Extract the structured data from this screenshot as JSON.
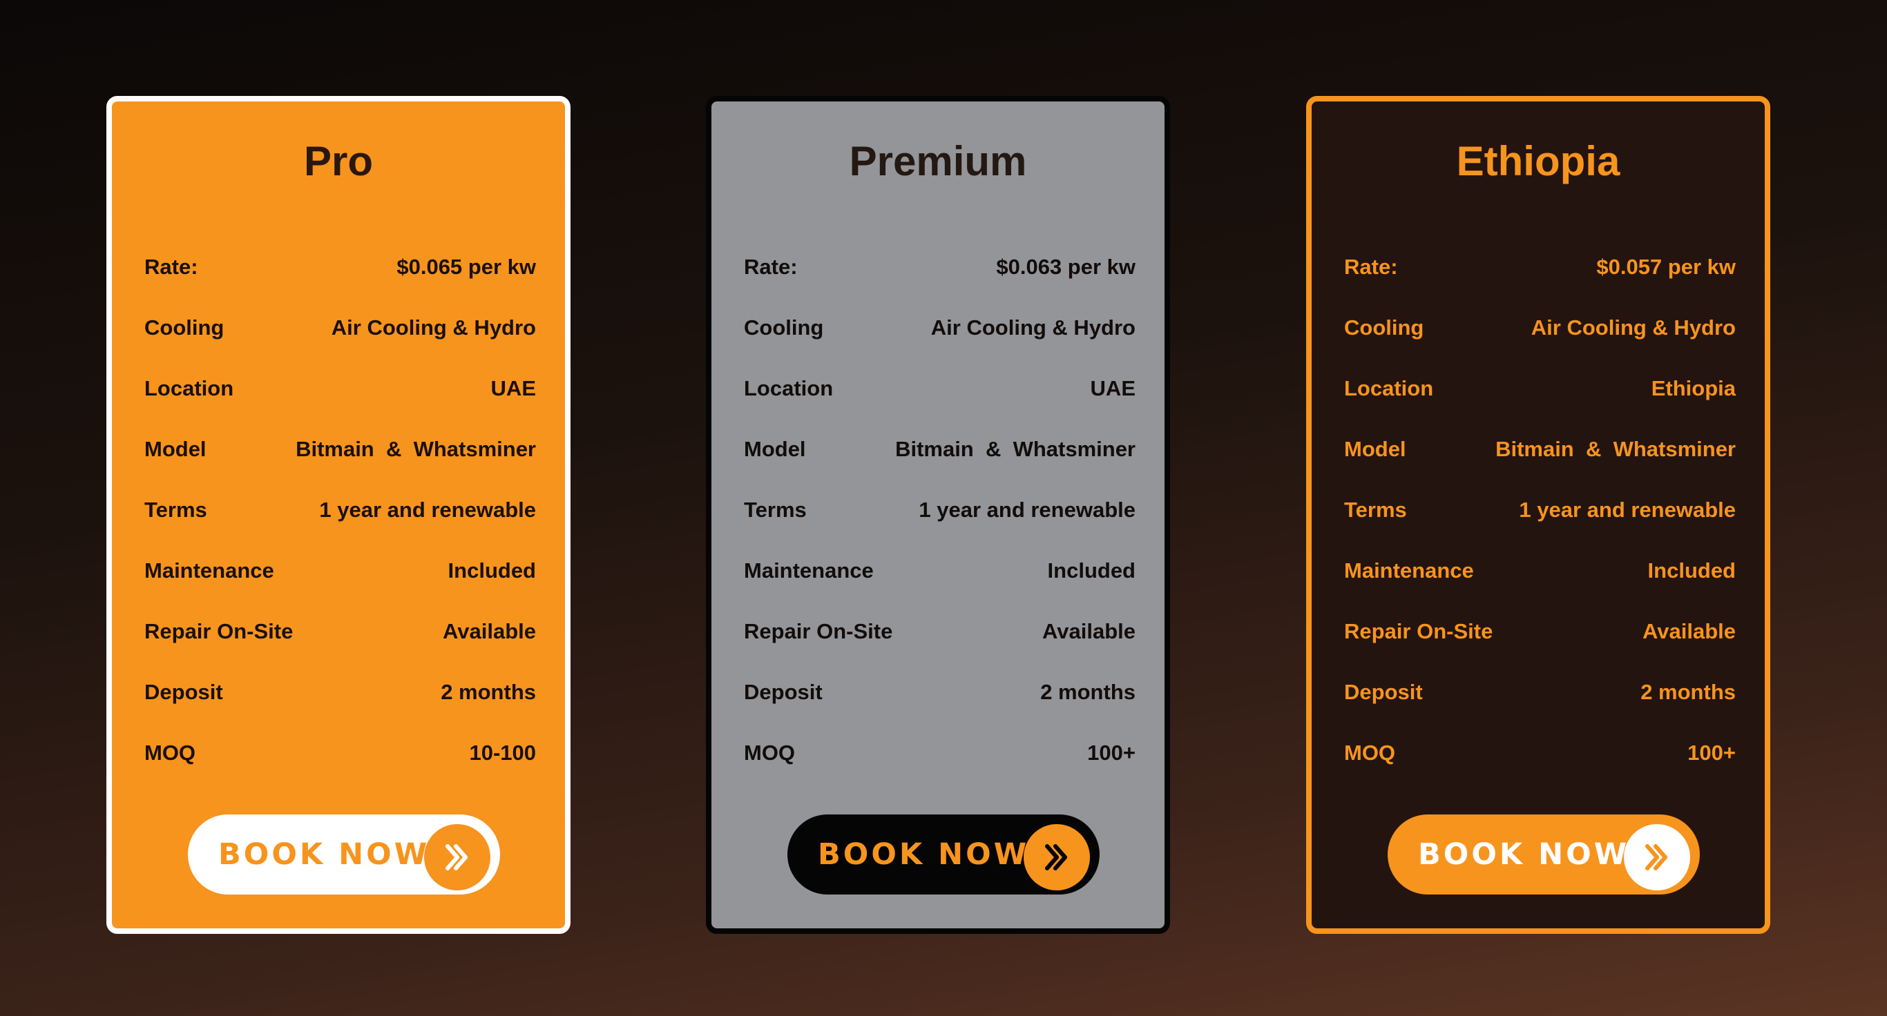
{
  "colors": {
    "accent": "#f7941d",
    "premium_bg": "#939598",
    "dark_bg": "#241410"
  },
  "plans": [
    {
      "id": "pro",
      "title": "Pro",
      "rows": [
        {
          "label": "Rate:",
          "value": "$0.065 per kw"
        },
        {
          "label": "Cooling",
          "value": "Air Cooling & Hydro"
        },
        {
          "label": "Location",
          "value": "UAE"
        },
        {
          "label": "Model",
          "value": "Bitmain  &  Whatsminer"
        },
        {
          "label": "Terms",
          "value": "1 year and renewable"
        },
        {
          "label": "Maintenance",
          "value": "Included"
        },
        {
          "label": "Repair On-Site",
          "value": "Available"
        },
        {
          "label": "Deposit",
          "value": "2 months"
        },
        {
          "label": "MOQ",
          "value": "10-100"
        }
      ],
      "button_label": "BOOK NOW",
      "button_icon": "double-chevron-right-icon",
      "arrow_color": "#ffffff"
    },
    {
      "id": "premium",
      "title": "Premium",
      "rows": [
        {
          "label": "Rate:",
          "value": "$0.063 per kw"
        },
        {
          "label": "Cooling",
          "value": "Air Cooling & Hydro"
        },
        {
          "label": "Location",
          "value": "UAE"
        },
        {
          "label": "Model",
          "value": "Bitmain  &  Whatsminer"
        },
        {
          "label": "Terms",
          "value": "1 year and renewable"
        },
        {
          "label": "Maintenance",
          "value": "Included"
        },
        {
          "label": "Repair On-Site",
          "value": "Available"
        },
        {
          "label": "Deposit",
          "value": "2 months"
        },
        {
          "label": "MOQ",
          "value": "100+"
        }
      ],
      "button_label": "BOOK NOW",
      "button_icon": "double-chevron-right-icon",
      "arrow_color": "#050505"
    },
    {
      "id": "ethiopia",
      "title": "Ethiopia",
      "rows": [
        {
          "label": "Rate:",
          "value": "$0.057 per kw"
        },
        {
          "label": "Cooling",
          "value": "Air Cooling & Hydro"
        },
        {
          "label": "Location",
          "value": "Ethiopia"
        },
        {
          "label": "Model",
          "value": "Bitmain  &  Whatsminer"
        },
        {
          "label": "Terms",
          "value": "1 year and renewable"
        },
        {
          "label": "Maintenance",
          "value": "Included"
        },
        {
          "label": "Repair On-Site",
          "value": "Available"
        },
        {
          "label": "Deposit",
          "value": "2 months"
        },
        {
          "label": "MOQ",
          "value": "100+"
        }
      ],
      "button_label": "BOOK NOW",
      "button_icon": "double-chevron-right-icon",
      "arrow_color": "#f7941d"
    }
  ]
}
